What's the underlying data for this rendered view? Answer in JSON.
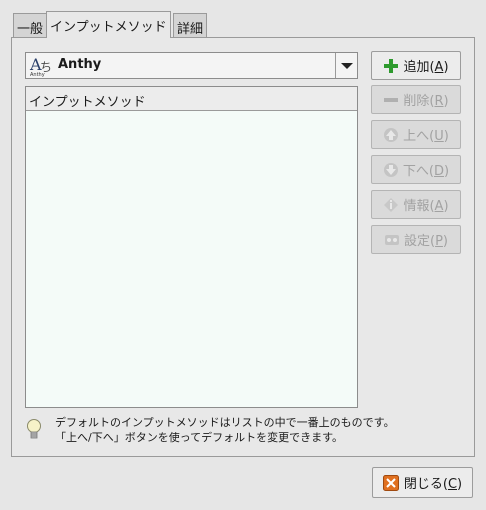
{
  "tabs": [
    {
      "label": "一般"
    },
    {
      "label": "インプットメソッド"
    },
    {
      "label": "詳細"
    }
  ],
  "combo": {
    "selected": "Anthy",
    "icon_text": "A"
  },
  "list": {
    "header": "インプットメソッド"
  },
  "buttons": {
    "add": {
      "prefix": "追加(",
      "mnemonic": "A",
      "suffix": ")"
    },
    "remove": {
      "prefix": "削除(",
      "mnemonic": "R",
      "suffix": ")"
    },
    "up": {
      "prefix": "上へ(",
      "mnemonic": "U",
      "suffix": ")"
    },
    "down": {
      "prefix": "下へ(",
      "mnemonic": "D",
      "suffix": ")"
    },
    "info": {
      "prefix": "情報(",
      "mnemonic": "A",
      "suffix": ")"
    },
    "settings": {
      "prefix": "設定(",
      "mnemonic": "P",
      "suffix": ")"
    }
  },
  "info": {
    "line1": "デフォルトのインプットメソッドはリストの中で一番上のものです。",
    "line2": "「上へ/下へ」ボタンを使ってデフォルトを変更できます。"
  },
  "close": {
    "prefix": "閉じる(",
    "mnemonic": "C",
    "suffix": ")"
  },
  "colors": {
    "add_icon": "#2e9a2e",
    "close_icon": "#e07020",
    "list_bg": "#f4fbf8"
  }
}
